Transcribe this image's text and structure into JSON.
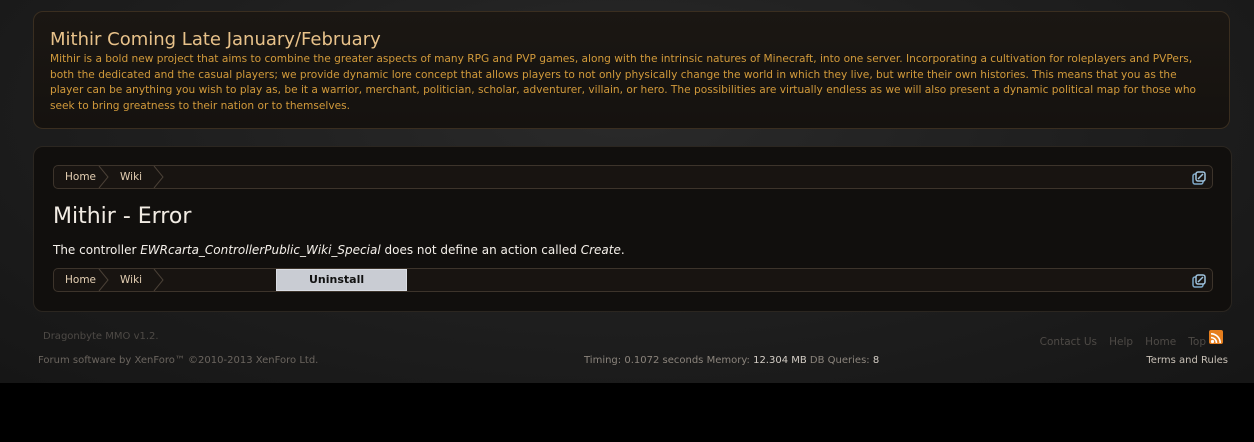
{
  "notice": {
    "title": "Mithir Coming Late January/February",
    "body": "Mithir is a bold new project that aims to combine the greater aspects of many RPG and PVP games, along with the intrinsic natures of Minecraft, into one server. Incorporating a cultivation for roleplayers and PVPers, both the dedicated and the casual players; we provide dynamic lore concept that allows players to not only physically change the world in which they live, but write their own histories. This means that you as the player can be anything you wish to play as, be it a warrior, merchant, politician, scholar, adventurer, villain, or hero. The possibilities are virtually endless as we will also present a dynamic political map for those who seek to bring greatness to their nation or to themselves."
  },
  "breadcrumb": {
    "home": "Home",
    "wiki": "Wiki"
  },
  "main": {
    "title": "Mithir - Error",
    "message_prefix": "The controller ",
    "controller": "EWRcarta_ControllerPublic_Wiki_Special",
    "message_middle": " does not define an action called ",
    "action": "Create",
    "message_suffix": "."
  },
  "uninstall_label": "Uninstall",
  "footer": {
    "brand": "Dragonbyte MMO v1.2.",
    "links": [
      "Contact Us",
      "Help",
      "Home",
      "Top"
    ],
    "copyright": "Forum software by XenForo™ ©2010-2013 XenForo Ltd.",
    "timing_label": "Timing: ",
    "timing_value": "0.1072",
    "timing_unit": " seconds Memory: ",
    "memory_value": "12.304 MB",
    "db_label": " DB Queries: ",
    "db_value": "8",
    "terms": "Terms and Rules"
  },
  "colors": {
    "accent": "#d29a3b",
    "rss": "#e67e1d"
  }
}
